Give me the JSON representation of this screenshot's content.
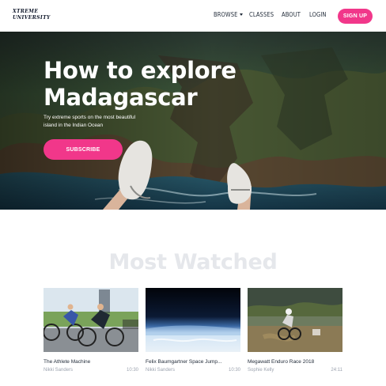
{
  "header": {
    "logo_line1": "XTREME",
    "logo_line2": "UNIVERSITY",
    "nav": {
      "browse": "BROWSE",
      "classes": "CLASSES",
      "about": "ABOUT",
      "login": "LOGIN"
    },
    "signup_label": "SIGN UP"
  },
  "hero": {
    "title_line1": "How to explore",
    "title_line2": "Madagascar",
    "subtitle_line1": "Try extreme sports on the most beautiful",
    "subtitle_line2": "island in the Indian Ocean",
    "cta_label": "SUBSCRIBE"
  },
  "most_watched": {
    "title": "Most Watched",
    "videos": [
      {
        "title": "The Athlete Machine",
        "author": "Nikki Sanders",
        "duration": "10:30"
      },
      {
        "title": "Felix Baumgartner Space Jump...",
        "author": "Nikki Sanders",
        "duration": "10:30"
      },
      {
        "title": "Megawatt Enduro Race 2018",
        "author": "Sophie Kelly",
        "duration": "24:11"
      }
    ]
  },
  "colors": {
    "accent": "#f1378a",
    "section_title": "#e5e7eb"
  }
}
